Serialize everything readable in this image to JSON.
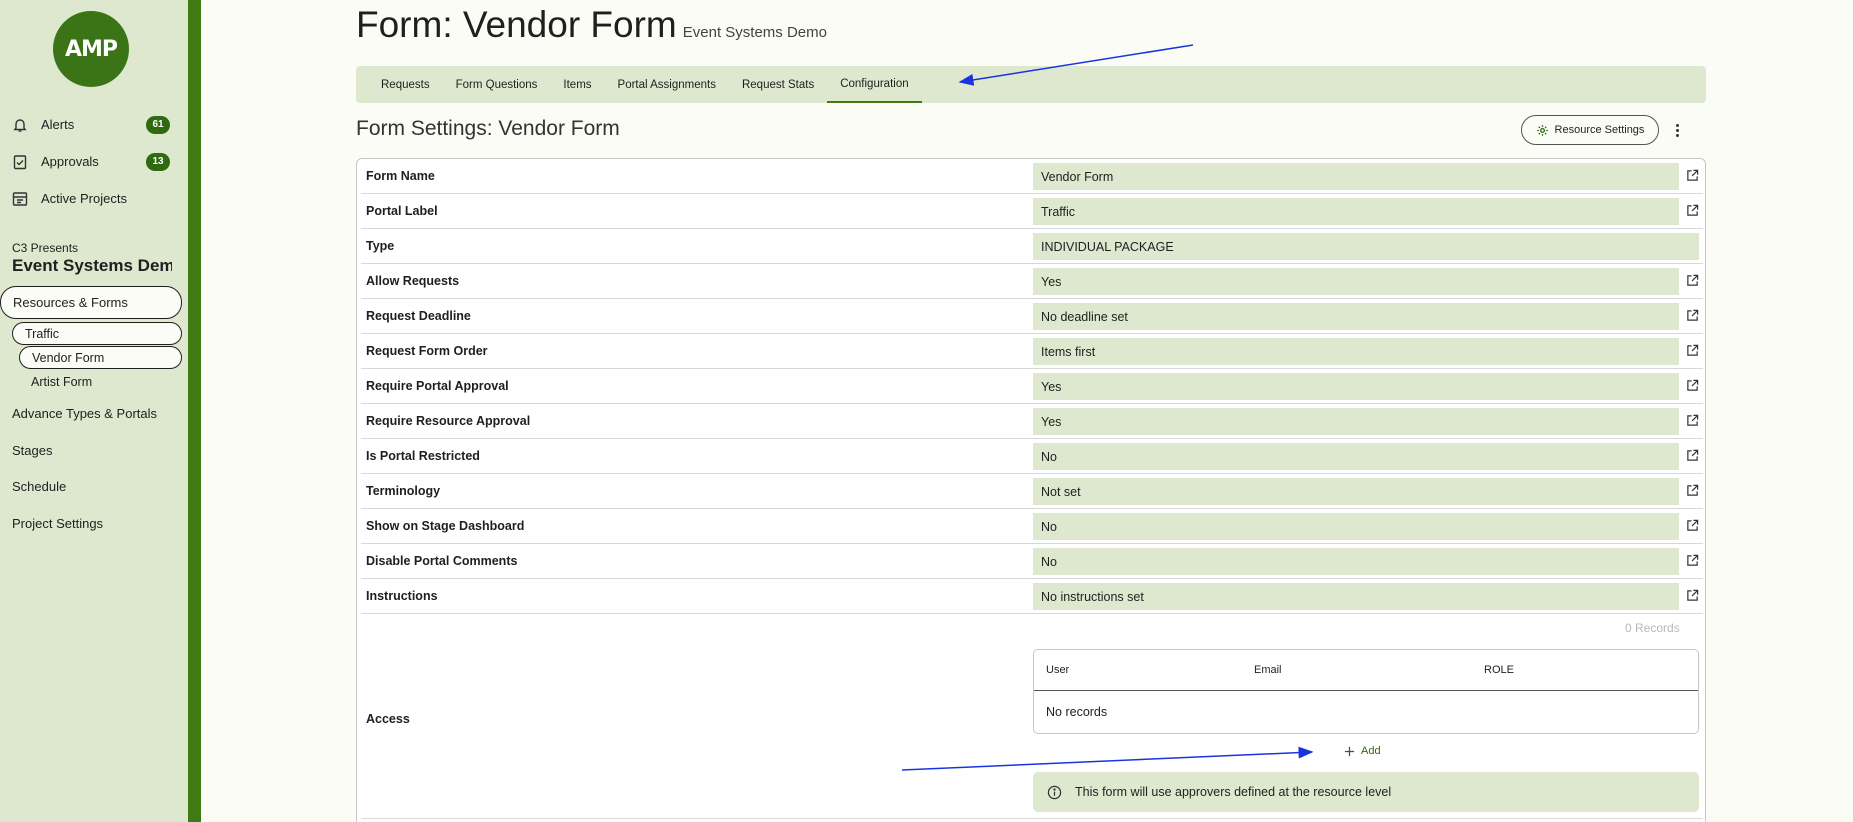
{
  "sidebar": {
    "logo_text": "AMP",
    "nav_top": [
      {
        "label": "Alerts",
        "badge": "61",
        "icon": "bell-icon"
      },
      {
        "label": "Approvals",
        "badge": "13",
        "icon": "checklist-icon"
      },
      {
        "label": "Active Projects",
        "badge": "",
        "icon": "projects-icon"
      }
    ],
    "org_name": "C3 Presents",
    "project_name": "Event Systems Demo",
    "resources_label": "Resources & Forms",
    "traffic_label": "Traffic",
    "vendor_form_label": "Vendor Form",
    "artist_form_label": "Artist Form",
    "advance_label": "Advance Types & Portals",
    "stages_label": "Stages",
    "schedule_label": "Schedule",
    "project_settings_label": "Project Settings"
  },
  "header": {
    "title": "Form: Vendor Form",
    "subtitle": "Event Systems Demo"
  },
  "tabs": [
    {
      "label": "Requests"
    },
    {
      "label": "Form Questions"
    },
    {
      "label": "Items"
    },
    {
      "label": "Portal Assignments"
    },
    {
      "label": "Request Stats"
    },
    {
      "label": "Configuration"
    }
  ],
  "settings": {
    "title": "Form Settings: Vendor Form",
    "resource_settings_label": "Resource Settings",
    "rows": [
      {
        "label": "Form Name",
        "value": "Vendor Form"
      },
      {
        "label": "Portal Label",
        "value": "Traffic"
      },
      {
        "label": "Type",
        "value": "INDIVIDUAL PACKAGE"
      },
      {
        "label": "Allow Requests",
        "value": "Yes"
      },
      {
        "label": "Request Deadline",
        "value": "No deadline set"
      },
      {
        "label": "Request Form Order",
        "value": "Items first"
      },
      {
        "label": "Require Portal Approval",
        "value": "Yes"
      },
      {
        "label": "Require Resource Approval",
        "value": "Yes"
      },
      {
        "label": "Is Portal Restricted",
        "value": "No"
      },
      {
        "label": "Terminology",
        "value": "Not set"
      },
      {
        "label": "Show on Stage Dashboard",
        "value": "No"
      },
      {
        "label": "Disable Portal Comments",
        "value": "No"
      },
      {
        "label": "Instructions",
        "value": "No instructions set"
      }
    ],
    "access": {
      "label": "Access",
      "records_count": "0 Records",
      "columns": [
        "User",
        "Email",
        "ROLE"
      ],
      "empty_text": "No records",
      "add_label": "Add",
      "info_text": "This form will use approvers defined at the resource level"
    }
  },
  "colors": {
    "accent": "#3f7a13",
    "panel": "#dde8cf",
    "annotation_arrow": "#1a33e0"
  }
}
